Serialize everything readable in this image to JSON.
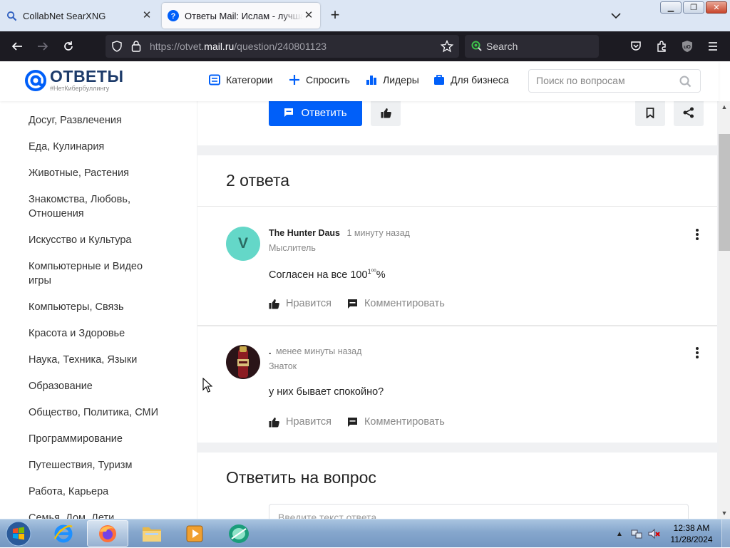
{
  "browser": {
    "tabs": [
      {
        "title": "CollabNet SearXNG",
        "active": false
      },
      {
        "title": "Ответы Mail: Ислам - лучшая",
        "active": true
      }
    ],
    "url_prefix": "https://otvet.",
    "url_domain": "mail.ru",
    "url_path": "/question/240801123",
    "search_placeholder": "Search"
  },
  "site": {
    "logo_name": "ОТВЕТЫ",
    "logo_tagline": "#НетКибербуллингу",
    "nav": {
      "categories": "Категории",
      "ask": "Спросить",
      "leaders": "Лидеры",
      "business": "Для бизнеса"
    },
    "search_placeholder": "Поиск по вопросам"
  },
  "sidebar": {
    "items": [
      "Досуг, Развлечения",
      "Еда, Кулинария",
      "Животные, Растения",
      "Знакомства, Любовь, Отношения",
      "Искусство и Культура",
      "Компьютерные и Видео игры",
      "Компьютеры, Связь",
      "Красота и Здоровье",
      "Наука, Техника, Языки",
      "Образование",
      "Общество, Политика, СМИ",
      "Программирование",
      "Путешествия, Туризм",
      "Работа, Карьера",
      "Семья, Дом, Дети"
    ]
  },
  "question_actions": {
    "answer_button": "Ответить"
  },
  "answers": {
    "title": "2 ответа",
    "items": [
      {
        "avatar_letter": "V",
        "author": "The Hunter Daus",
        "time": "1 минуту назад",
        "rank": "Мыслитель",
        "text_main": "Согласен на все 100",
        "text_sup": "1⁰⁰",
        "text_tail": "%",
        "like_label": "Нравится",
        "comment_label": "Комментировать"
      },
      {
        "avatar_letter": "",
        "author": ".",
        "time": "менее минуты назад",
        "rank": "Знаток",
        "text_main": "у них бывает спокойно?",
        "like_label": "Нравится",
        "comment_label": "Комментировать"
      }
    ]
  },
  "reply": {
    "title": "Ответить на вопрос",
    "placeholder": "Введите текст ответа"
  },
  "taskbar": {
    "time": "12:38 AM",
    "date": "11/28/2024"
  },
  "colors": {
    "accent": "#005ff9",
    "brand": "#1d3b6a",
    "avatar_v": "#64d7c8"
  }
}
